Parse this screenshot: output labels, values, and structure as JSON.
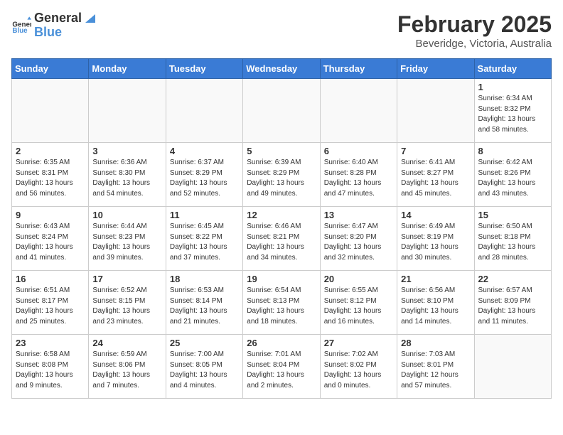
{
  "header": {
    "logo_general": "General",
    "logo_blue": "Blue",
    "month_year": "February 2025",
    "location": "Beveridge, Victoria, Australia"
  },
  "calendar": {
    "days_of_week": [
      "Sunday",
      "Monday",
      "Tuesday",
      "Wednesday",
      "Thursday",
      "Friday",
      "Saturday"
    ],
    "weeks": [
      [
        {
          "day": "",
          "info": ""
        },
        {
          "day": "",
          "info": ""
        },
        {
          "day": "",
          "info": ""
        },
        {
          "day": "",
          "info": ""
        },
        {
          "day": "",
          "info": ""
        },
        {
          "day": "",
          "info": ""
        },
        {
          "day": "1",
          "info": "Sunrise: 6:34 AM\nSunset: 8:32 PM\nDaylight: 13 hours\nand 58 minutes."
        }
      ],
      [
        {
          "day": "2",
          "info": "Sunrise: 6:35 AM\nSunset: 8:31 PM\nDaylight: 13 hours\nand 56 minutes."
        },
        {
          "day": "3",
          "info": "Sunrise: 6:36 AM\nSunset: 8:30 PM\nDaylight: 13 hours\nand 54 minutes."
        },
        {
          "day": "4",
          "info": "Sunrise: 6:37 AM\nSunset: 8:29 PM\nDaylight: 13 hours\nand 52 minutes."
        },
        {
          "day": "5",
          "info": "Sunrise: 6:39 AM\nSunset: 8:29 PM\nDaylight: 13 hours\nand 49 minutes."
        },
        {
          "day": "6",
          "info": "Sunrise: 6:40 AM\nSunset: 8:28 PM\nDaylight: 13 hours\nand 47 minutes."
        },
        {
          "day": "7",
          "info": "Sunrise: 6:41 AM\nSunset: 8:27 PM\nDaylight: 13 hours\nand 45 minutes."
        },
        {
          "day": "8",
          "info": "Sunrise: 6:42 AM\nSunset: 8:26 PM\nDaylight: 13 hours\nand 43 minutes."
        }
      ],
      [
        {
          "day": "9",
          "info": "Sunrise: 6:43 AM\nSunset: 8:24 PM\nDaylight: 13 hours\nand 41 minutes."
        },
        {
          "day": "10",
          "info": "Sunrise: 6:44 AM\nSunset: 8:23 PM\nDaylight: 13 hours\nand 39 minutes."
        },
        {
          "day": "11",
          "info": "Sunrise: 6:45 AM\nSunset: 8:22 PM\nDaylight: 13 hours\nand 37 minutes."
        },
        {
          "day": "12",
          "info": "Sunrise: 6:46 AM\nSunset: 8:21 PM\nDaylight: 13 hours\nand 34 minutes."
        },
        {
          "day": "13",
          "info": "Sunrise: 6:47 AM\nSunset: 8:20 PM\nDaylight: 13 hours\nand 32 minutes."
        },
        {
          "day": "14",
          "info": "Sunrise: 6:49 AM\nSunset: 8:19 PM\nDaylight: 13 hours\nand 30 minutes."
        },
        {
          "day": "15",
          "info": "Sunrise: 6:50 AM\nSunset: 8:18 PM\nDaylight: 13 hours\nand 28 minutes."
        }
      ],
      [
        {
          "day": "16",
          "info": "Sunrise: 6:51 AM\nSunset: 8:17 PM\nDaylight: 13 hours\nand 25 minutes."
        },
        {
          "day": "17",
          "info": "Sunrise: 6:52 AM\nSunset: 8:15 PM\nDaylight: 13 hours\nand 23 minutes."
        },
        {
          "day": "18",
          "info": "Sunrise: 6:53 AM\nSunset: 8:14 PM\nDaylight: 13 hours\nand 21 minutes."
        },
        {
          "day": "19",
          "info": "Sunrise: 6:54 AM\nSunset: 8:13 PM\nDaylight: 13 hours\nand 18 minutes."
        },
        {
          "day": "20",
          "info": "Sunrise: 6:55 AM\nSunset: 8:12 PM\nDaylight: 13 hours\nand 16 minutes."
        },
        {
          "day": "21",
          "info": "Sunrise: 6:56 AM\nSunset: 8:10 PM\nDaylight: 13 hours\nand 14 minutes."
        },
        {
          "day": "22",
          "info": "Sunrise: 6:57 AM\nSunset: 8:09 PM\nDaylight: 13 hours\nand 11 minutes."
        }
      ],
      [
        {
          "day": "23",
          "info": "Sunrise: 6:58 AM\nSunset: 8:08 PM\nDaylight: 13 hours\nand 9 minutes."
        },
        {
          "day": "24",
          "info": "Sunrise: 6:59 AM\nSunset: 8:06 PM\nDaylight: 13 hours\nand 7 minutes."
        },
        {
          "day": "25",
          "info": "Sunrise: 7:00 AM\nSunset: 8:05 PM\nDaylight: 13 hours\nand 4 minutes."
        },
        {
          "day": "26",
          "info": "Sunrise: 7:01 AM\nSunset: 8:04 PM\nDaylight: 13 hours\nand 2 minutes."
        },
        {
          "day": "27",
          "info": "Sunrise: 7:02 AM\nSunset: 8:02 PM\nDaylight: 13 hours\nand 0 minutes."
        },
        {
          "day": "28",
          "info": "Sunrise: 7:03 AM\nSunset: 8:01 PM\nDaylight: 12 hours\nand 57 minutes."
        },
        {
          "day": "",
          "info": ""
        }
      ]
    ]
  }
}
